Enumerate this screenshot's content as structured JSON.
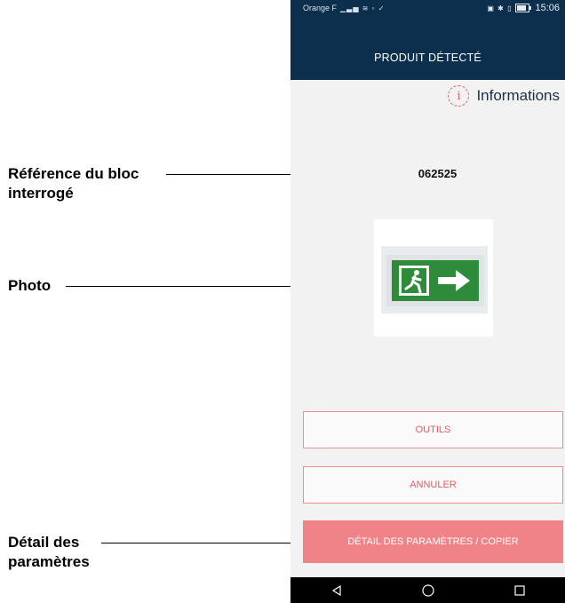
{
  "annotations": {
    "reference_line1": "Référence du bloc",
    "reference_line2": "interrogé",
    "photo": "Photo",
    "detail_line1": "Détail des",
    "detail_line2": "paramètres"
  },
  "status_bar": {
    "carrier": "Orange F",
    "time": "15:06",
    "battery": "71"
  },
  "header": {
    "title": "PRODUIT DÉTECTÉ"
  },
  "info": {
    "icon_glyph": "i",
    "label": "Informations"
  },
  "product": {
    "reference": "062525"
  },
  "buttons": {
    "outils": "OUTILS",
    "annuler": "ANNULER",
    "detail": "DÉTAIL DES PARAMÈTRES / COPIER"
  },
  "colors": {
    "header_bg": "#0b2f4d",
    "accent": "#e5595f",
    "primary_button": "#f08387",
    "sign_green": "#2e8b3a"
  },
  "icons": {
    "back": "back-triangle-icon",
    "home": "home-circle-icon",
    "recents": "recents-square-icon"
  }
}
